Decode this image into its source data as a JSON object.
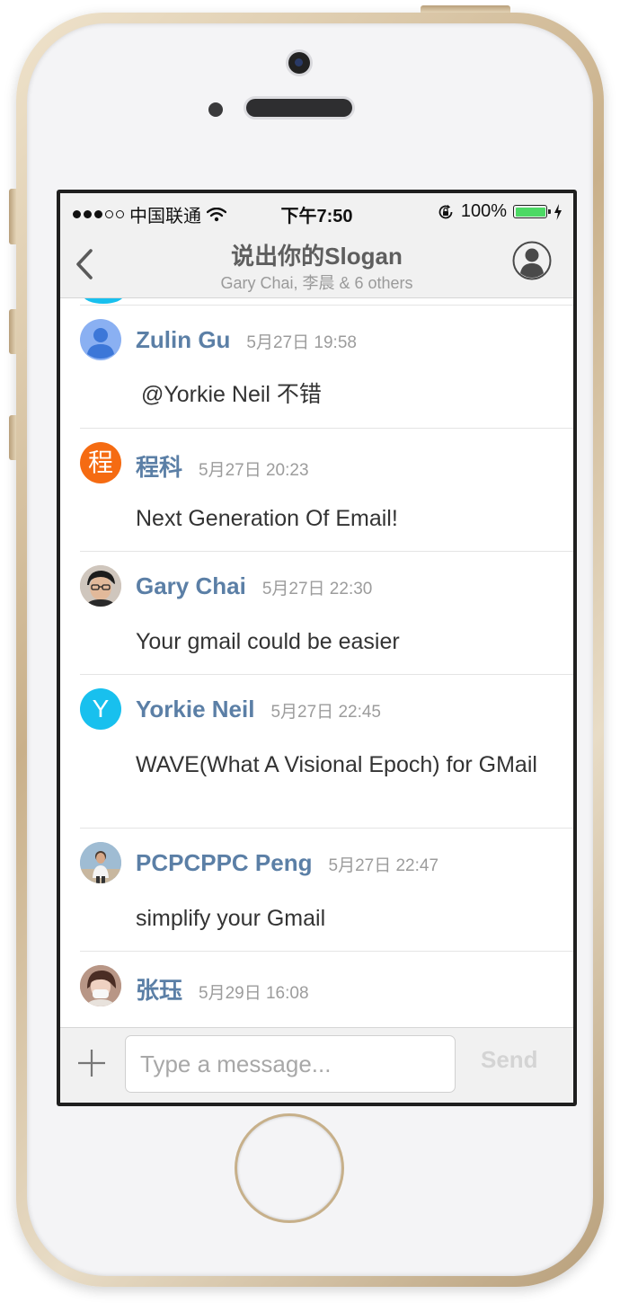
{
  "status_bar": {
    "carrier": "中国联通",
    "time": "下午7:50",
    "battery": "100%"
  },
  "nav": {
    "title": "说出你的Slogan",
    "subtitle": "Gary Chai, 李晨 & 6 others"
  },
  "messages": [
    {
      "sender": "Zulin Gu",
      "timestamp": "5月27日 19:58",
      "text": "@Yorkie Neil  不错",
      "avatar_letter": "",
      "avatar_color": "#8ab0f2"
    },
    {
      "sender": "程科",
      "timestamp": "5月27日 20:23",
      "text": "Next Generation Of Email!",
      "avatar_letter": "程",
      "avatar_color": "#f56b12"
    },
    {
      "sender": "Gary Chai",
      "timestamp": "5月27日 22:30",
      "text": "Your gmail could be easier",
      "avatar_letter": "",
      "avatar_color": "#3a3a3a"
    },
    {
      "sender": "Yorkie Neil",
      "timestamp": "5月27日 22:45",
      "text": "WAVE(What A Visional Epoch) for GMail",
      "avatar_letter": "Y",
      "avatar_color": "#18c0ee"
    },
    {
      "sender": "PCPCPPC Peng",
      "timestamp": "5月27日 22:47",
      "text": "simplify your Gmail",
      "avatar_letter": "",
      "avatar_color": "#b5c9d8"
    },
    {
      "sender": "张珏",
      "timestamp": "5月29日 16:08",
      "text": "",
      "avatar_letter": "",
      "avatar_color": "#c9a99a"
    }
  ],
  "composer": {
    "placeholder": "Type a message...",
    "send_label": "Send"
  },
  "colors": {
    "sender_name": "#5b7fa6",
    "timestamp": "#9c9c9c",
    "battery_fill": "#4cd964"
  }
}
